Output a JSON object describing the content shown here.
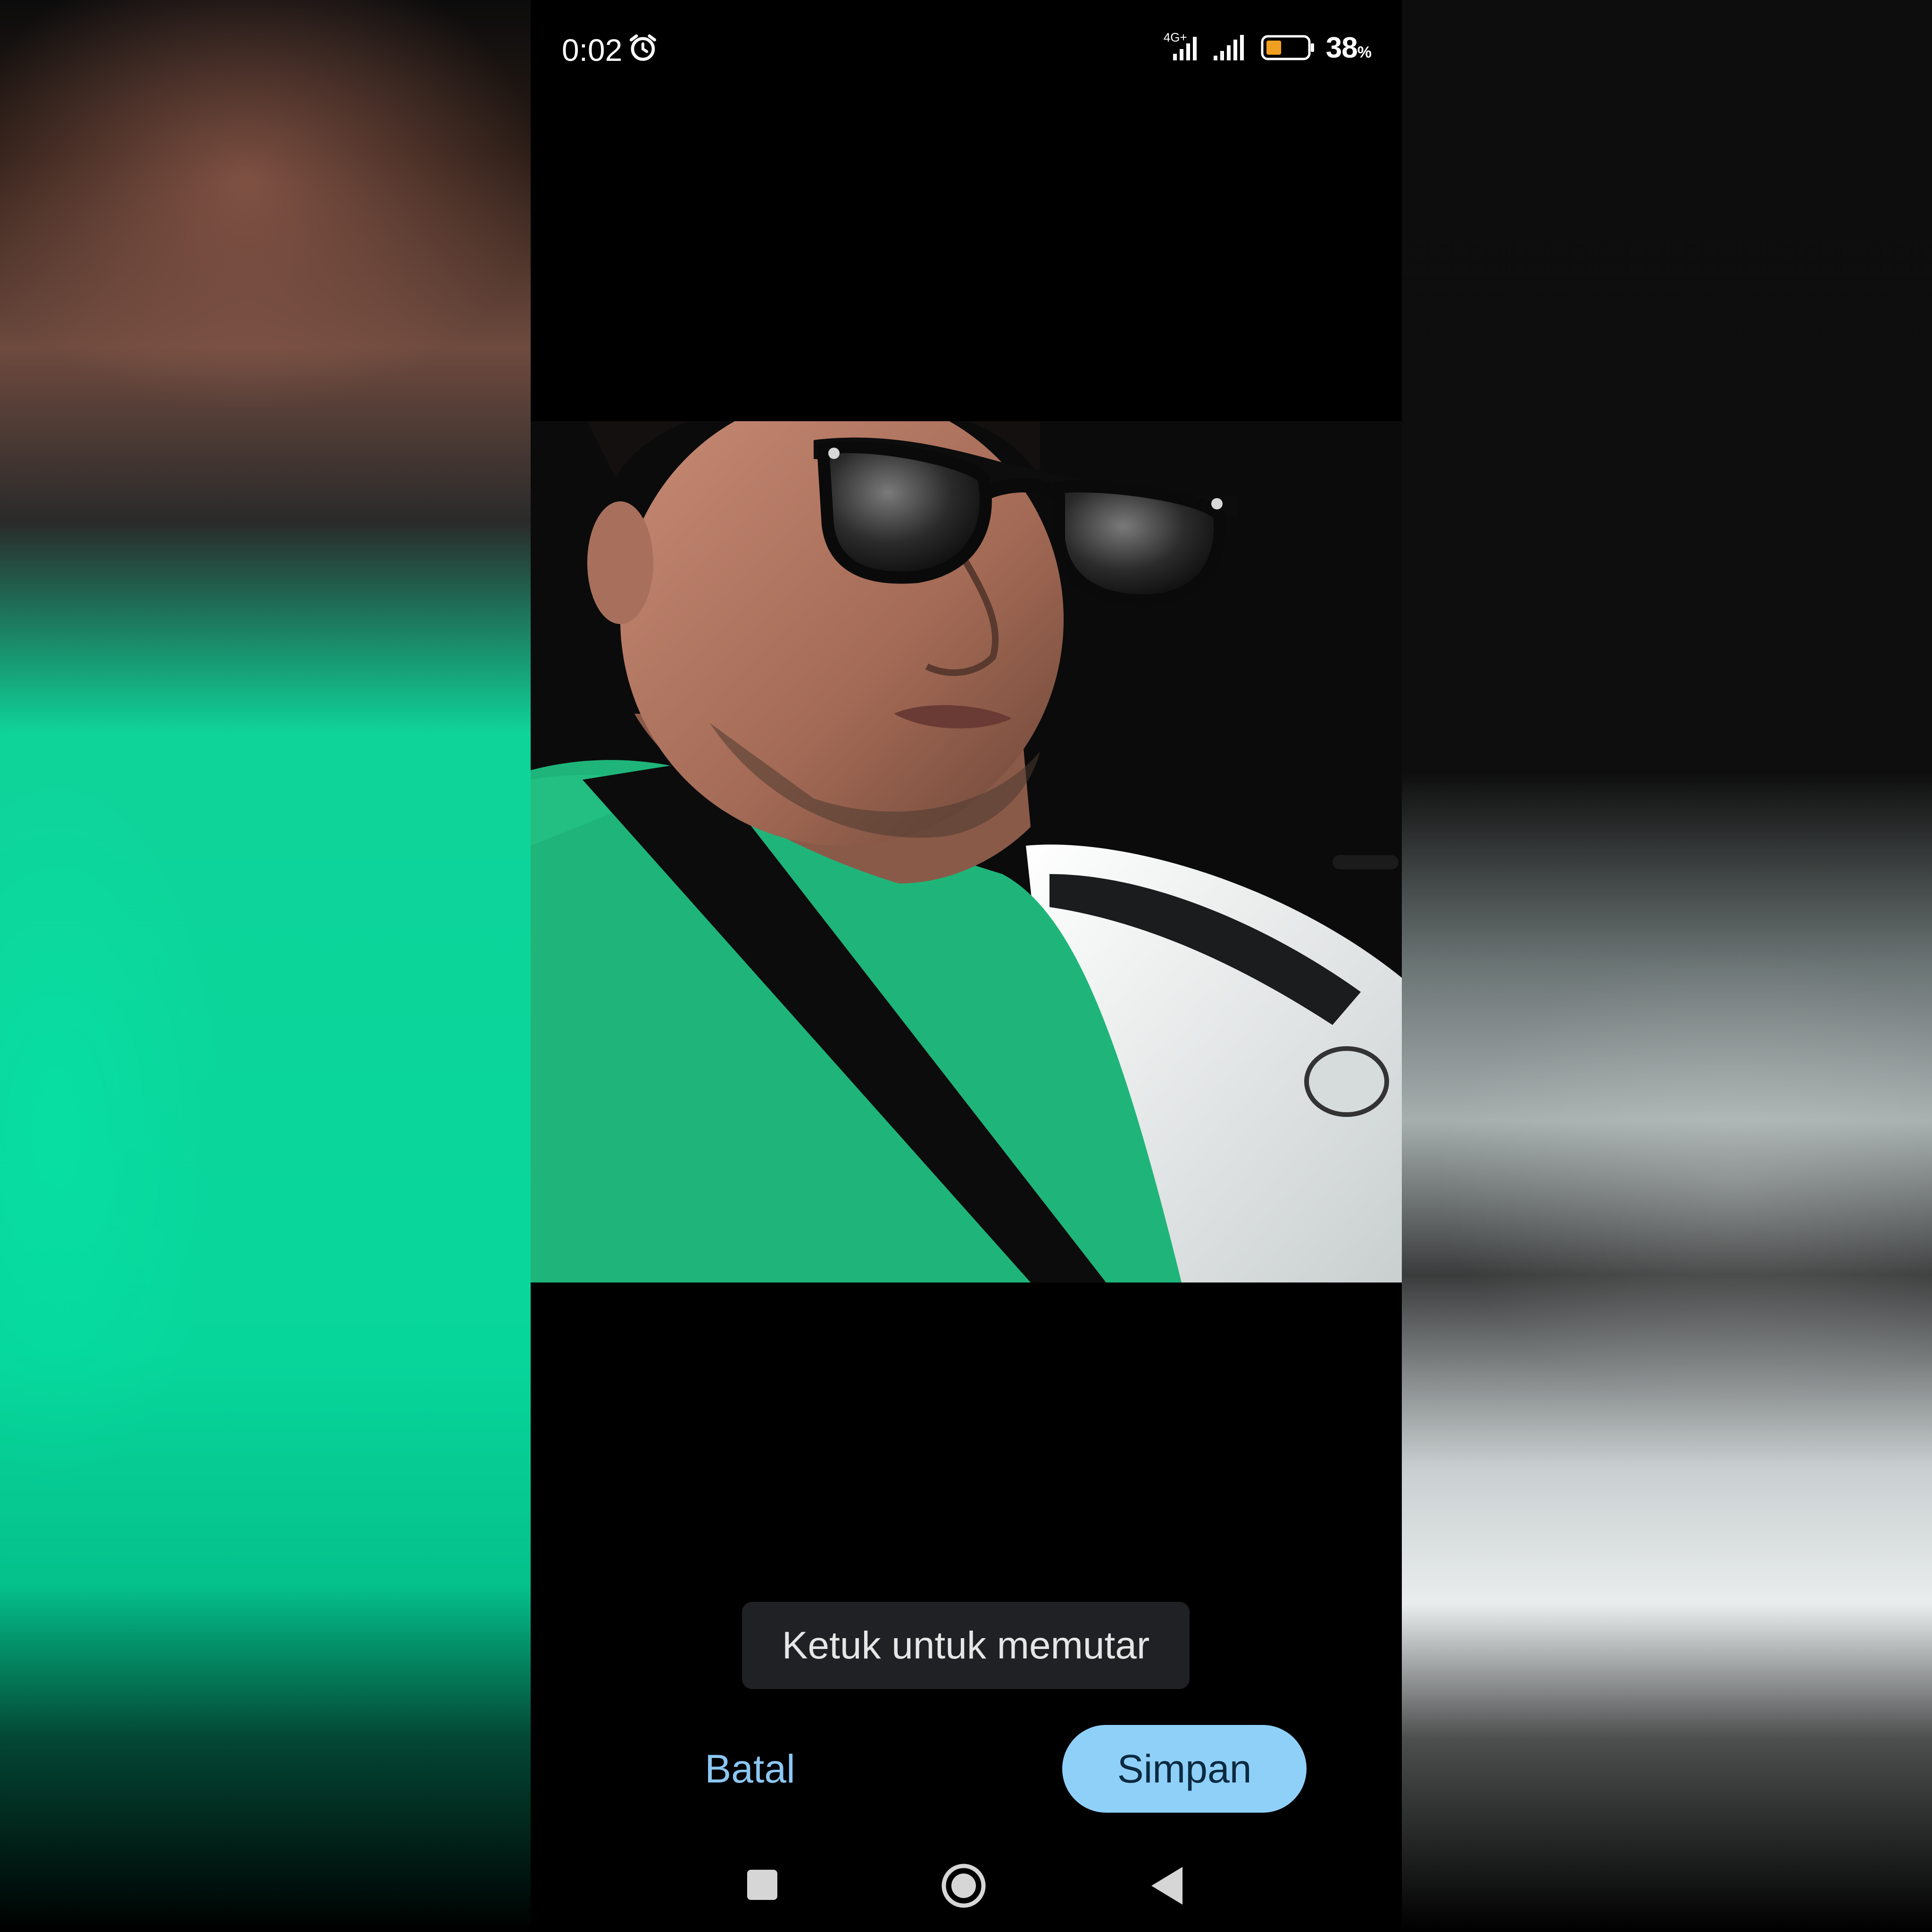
{
  "status_bar": {
    "time": "0:02",
    "network_type": "4G+",
    "battery_level": "38",
    "battery_percent_sign": "%",
    "battery_fill_fraction": 0.38,
    "battery_fill_color": "#f0a020"
  },
  "toast": {
    "text": "Ketuk untuk memutar"
  },
  "actions": {
    "cancel_label": "Batal",
    "save_label": "Simpan"
  },
  "colors": {
    "accent": "#8fd0f9",
    "cancel_text": "#8cc7f3",
    "toast_bg": "#202124"
  },
  "icons": {
    "alarm": "alarm-clock-icon",
    "signal_1": "signal-bars-icon",
    "signal_2": "signal-bars-icon",
    "battery": "battery-icon",
    "nav_recents": "square-icon",
    "nav_home": "circle-icon",
    "nav_back": "triangle-back-icon"
  }
}
